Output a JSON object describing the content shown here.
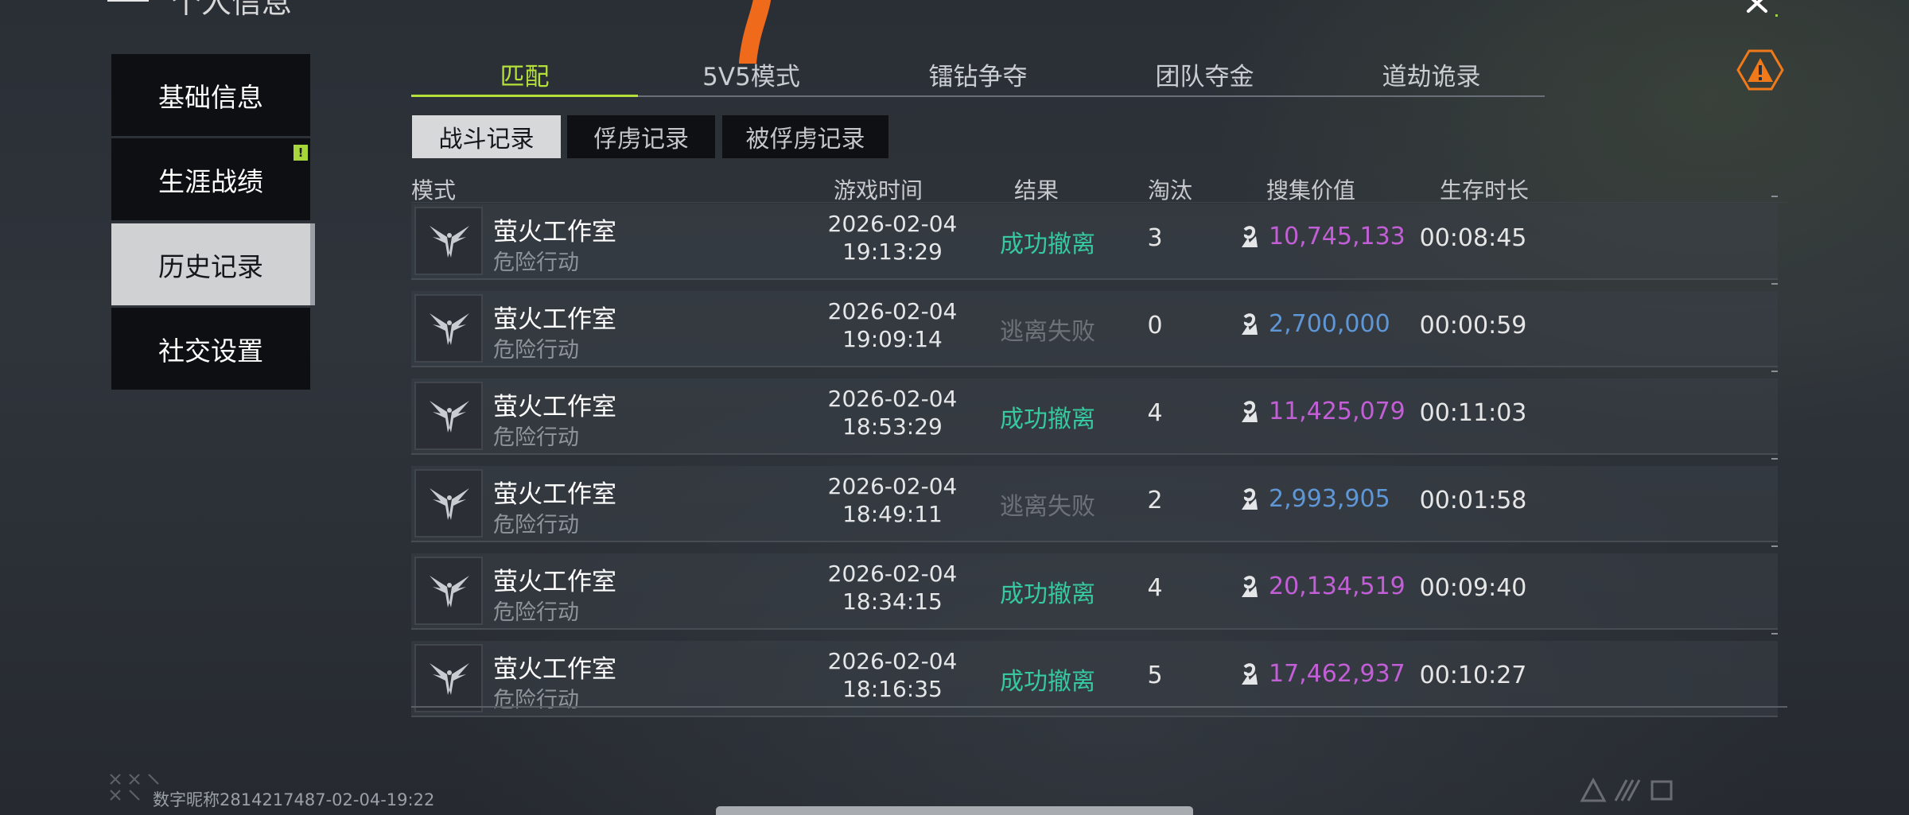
{
  "header": {
    "title": "个人信息"
  },
  "sidebar": {
    "items": [
      {
        "label": "基础信息",
        "selected": false,
        "alert": false
      },
      {
        "label": "生涯战绩",
        "selected": false,
        "alert": true,
        "alert_symbol": "!"
      },
      {
        "label": "历史记录",
        "selected": true,
        "alert": false
      },
      {
        "label": "社交设置",
        "selected": false,
        "alert": false
      }
    ]
  },
  "top_tabs": [
    {
      "label": "匹配",
      "active": true
    },
    {
      "label": "5V5模式",
      "active": false
    },
    {
      "label": "镭钻争夺",
      "active": false
    },
    {
      "label": "团队夺金",
      "active": false
    },
    {
      "label": "道劫诡录",
      "active": false
    }
  ],
  "sub_tabs": [
    {
      "label": "战斗记录",
      "active": true
    },
    {
      "label": "俘虏记录",
      "active": false
    },
    {
      "label": "被俘虏记录",
      "active": false
    }
  ],
  "table": {
    "columns": [
      "模式",
      "游戏时间",
      "结果",
      "淘汰",
      "搜集价值",
      "生存时长"
    ],
    "rows": [
      {
        "mode": "萤火工作室",
        "mode_sub": "危险行动",
        "date": "2026-02-04",
        "time": "19:13:29",
        "result": "成功撤离",
        "result_type": "success",
        "kills": "3",
        "value": "10,745,133",
        "value_color": "#c25fd6",
        "survival": "00:08:45"
      },
      {
        "mode": "萤火工作室",
        "mode_sub": "危险行动",
        "date": "2026-02-04",
        "time": "19:09:14",
        "result": "逃离失败",
        "result_type": "fail",
        "kills": "0",
        "value": "2,700,000",
        "value_color": "#5f97d6",
        "survival": "00:00:59"
      },
      {
        "mode": "萤火工作室",
        "mode_sub": "危险行动",
        "date": "2026-02-04",
        "time": "18:53:29",
        "result": "成功撤离",
        "result_type": "success",
        "kills": "4",
        "value": "11,425,079",
        "value_color": "#c25fd6",
        "survival": "00:11:03"
      },
      {
        "mode": "萤火工作室",
        "mode_sub": "危险行动",
        "date": "2026-02-04",
        "time": "18:49:11",
        "result": "逃离失败",
        "result_type": "fail",
        "kills": "2",
        "value": "2,993,905",
        "value_color": "#5f97d6",
        "survival": "00:01:58"
      },
      {
        "mode": "萤火工作室",
        "mode_sub": "危险行动",
        "date": "2026-02-04",
        "time": "18:34:15",
        "result": "成功撤离",
        "result_type": "success",
        "kills": "4",
        "value": "20,134,519",
        "value_color": "#c25fd6",
        "survival": "00:09:40"
      },
      {
        "mode": "萤火工作室",
        "mode_sub": "危险行动",
        "date": "2026-02-04",
        "time": "18:16:35",
        "result": "成功撤离",
        "result_type": "success",
        "kills": "5",
        "value": "17,462,937",
        "value_color": "#c25fd6",
        "survival": "00:10:27"
      }
    ]
  },
  "footer": {
    "player_id": "数字昵称2814217487-02-04-19:22"
  },
  "icons": {
    "close": "close-icon",
    "warning": "warning-icon",
    "emblem": "winged-emblem-icon",
    "coin": "currency-icon"
  },
  "colors": {
    "accent": "#b5e03a",
    "success": "#36c99f",
    "fail": "#6d7278",
    "value_high": "#c25fd6",
    "value_low": "#5f97d6",
    "warning": "#f07a1a"
  }
}
